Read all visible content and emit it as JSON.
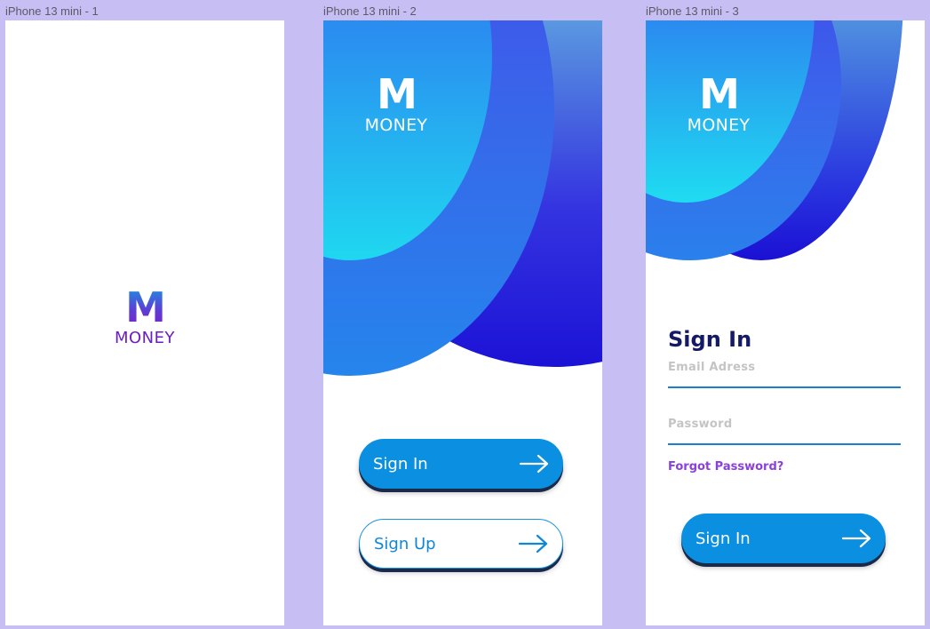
{
  "frames": {
    "splash": {
      "label": "iPhone 13 mini - 1",
      "logo_letter": "M",
      "logo_word": "MONEY"
    },
    "welcome": {
      "label": "iPhone 13 mini - 2",
      "logo_letter": "M",
      "logo_word": "MONEY",
      "signin_label": "Sign In",
      "signup_label": "Sign Up"
    },
    "signin": {
      "label": "iPhone 13 mini - 3",
      "logo_letter": "M",
      "logo_word": "MONEY",
      "title": "Sign In",
      "email_placeholder": "Email  Adress",
      "password_placeholder": "Password",
      "forgot_label": "Forgot Password?",
      "signin_label": "Sign In"
    }
  },
  "colors": {
    "canvas": "#c7bff3",
    "button": "#0b8fe0",
    "title": "#141a66",
    "link": "#8a3fe0",
    "logo_gradient_top": "#1f8fe0",
    "logo_gradient_bottom": "#7a22c9"
  },
  "icons": {
    "arrow": "arrow-right-icon"
  }
}
